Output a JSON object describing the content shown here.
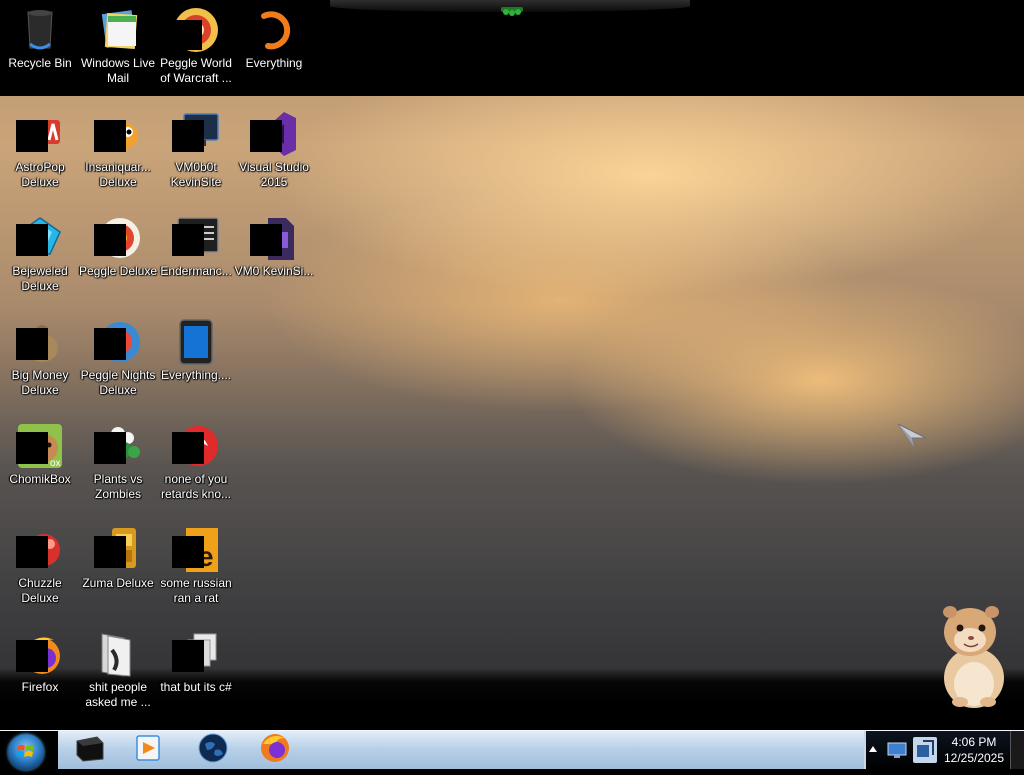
{
  "desktop": {
    "icons": [
      {
        "label": "Recycle Bin",
        "icon": "recycle-bin-icon"
      },
      {
        "label": "Windows Live Mail",
        "icon": "windows-live-mail-icon"
      },
      {
        "label": "Peggle World of Warcraft ...",
        "icon": "peggle-wow-icon"
      },
      {
        "label": "Everything",
        "icon": "everything-icon"
      },
      {
        "label": "AstroPop Deluxe",
        "icon": "astropop-icon"
      },
      {
        "label": "Insaniquar... Deluxe",
        "icon": "insaniquarium-icon"
      },
      {
        "label": "VM0b0t KevinSite",
        "icon": "vm-icon"
      },
      {
        "label": "Visual Studio 2015",
        "icon": "visual-studio-icon"
      },
      {
        "label": "Bejeweled Deluxe",
        "icon": "bejeweled-icon"
      },
      {
        "label": "Peggle Deluxe",
        "icon": "peggle-icon"
      },
      {
        "label": "Endermanc...",
        "icon": "console-icon"
      },
      {
        "label": "VM0 KevinSi...",
        "icon": "vs-document-icon"
      },
      {
        "label": "Big Money Deluxe",
        "icon": "money-bag-icon"
      },
      {
        "label": "Peggle Nights Deluxe",
        "icon": "peggle-nights-icon"
      },
      {
        "label": "Everything....",
        "icon": "tablet-icon"
      },
      {
        "label": "ChomikBox",
        "icon": "chomikbox-icon"
      },
      {
        "label": "Plants vs Zombies",
        "icon": "plants-vs-zombies-icon"
      },
      {
        "label": "none of you retards kno...",
        "icon": "red-circle-icon"
      },
      {
        "label": "Chuzzle Deluxe",
        "icon": "chuzzle-icon"
      },
      {
        "label": "Zuma Deluxe",
        "icon": "zuma-icon"
      },
      {
        "label": "some russian ran a rat",
        "icon": "document-e-icon"
      },
      {
        "label": "Firefox",
        "icon": "firefox-icon"
      },
      {
        "label": "shit people asked me ...",
        "icon": "folder-icon"
      },
      {
        "label": "that but its c#",
        "icon": "stacked-files-icon"
      }
    ]
  },
  "taskbar": {
    "start": "start-orb-icon",
    "pinned": [
      {
        "icon": "terminal-icon"
      },
      {
        "icon": "media-player-icon"
      },
      {
        "icon": "earth-icon"
      },
      {
        "icon": "firefox-icon"
      }
    ],
    "tray": {
      "time": "4:06 PM",
      "date": "12/25/2025"
    }
  },
  "colors": {
    "taskbar_top": "#e3eef8",
    "taskbar_bottom": "#9fbedd",
    "label_text": "#ffffff",
    "wallpaper_glow": "#f3c58a"
  }
}
